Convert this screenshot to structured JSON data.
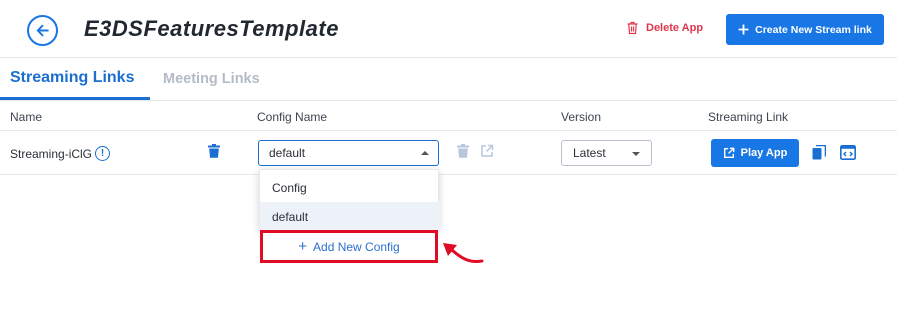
{
  "header": {
    "title": "E3DSFeaturesTemplate",
    "delete_label": "Delete App",
    "create_label": "Create New Stream link"
  },
  "tabs": [
    {
      "label": "Streaming Links",
      "active": true
    },
    {
      "label": "Meeting Links",
      "active": false
    }
  ],
  "table": {
    "columns": [
      "Name",
      "Config Name",
      "Version",
      "Streaming Link"
    ],
    "rows": [
      {
        "name": "Streaming-iClG",
        "config": "default",
        "version": "Latest",
        "play_label": "Play App"
      }
    ]
  },
  "config_dropdown": {
    "options": [
      "Config",
      "default"
    ],
    "selected": "default",
    "add_label": "Add New Config"
  },
  "colors": {
    "accent": "#1877e5",
    "danger": "#e0364d",
    "highlight": "#e00b25",
    "muted": "#b3bcc8"
  }
}
